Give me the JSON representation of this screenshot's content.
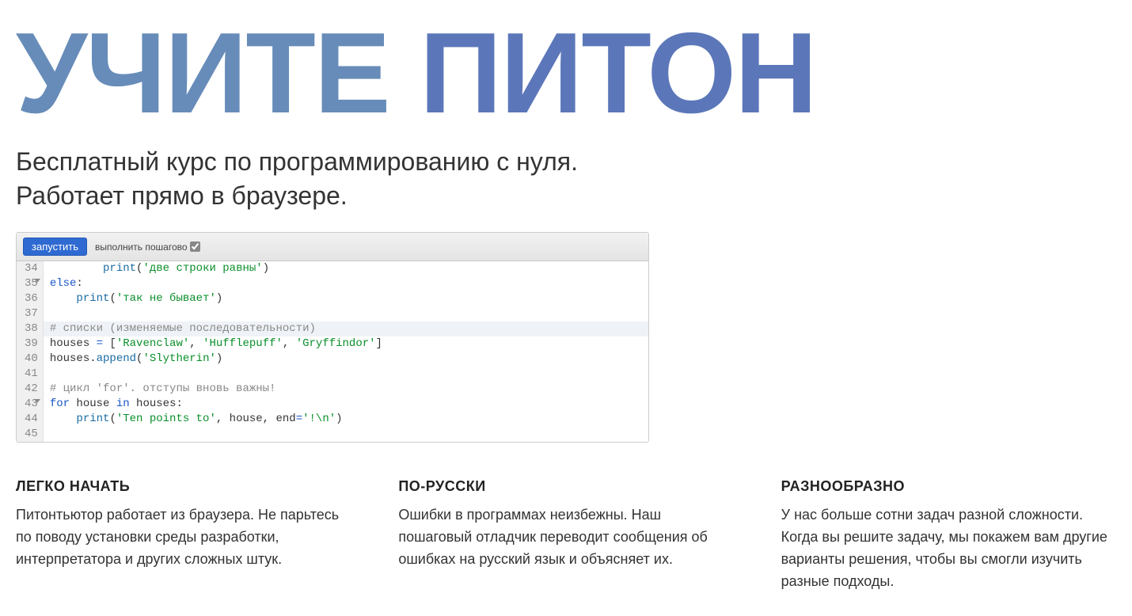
{
  "title": {
    "word1": "УЧИТЕ",
    "word2": "ПИТОН"
  },
  "subtitle_line1": "Бесплатный курс по программированию с нуля.",
  "subtitle_line2": "Работает прямо в браузере.",
  "editor": {
    "run_label": "запустить",
    "step_label": "выполнить пошагово",
    "step_checked": true,
    "line_numbers": [
      "34",
      "35",
      "36",
      "37",
      "38",
      "39",
      "40",
      "41",
      "42",
      "43",
      "44",
      "45"
    ],
    "fold_lines": [
      35,
      43
    ],
    "code_lines": [
      {
        "indent": 2,
        "tokens": [
          {
            "t": "fn",
            "v": "print"
          },
          {
            "t": "",
            "v": "("
          },
          {
            "t": "str",
            "v": "'две строки равны'"
          },
          {
            "t": "",
            "v": ")"
          }
        ]
      },
      {
        "indent": 0,
        "tokens": [
          {
            "t": "kw",
            "v": "else"
          },
          {
            "t": "",
            "v": ":"
          }
        ]
      },
      {
        "indent": 1,
        "tokens": [
          {
            "t": "fn",
            "v": "print"
          },
          {
            "t": "",
            "v": "("
          },
          {
            "t": "str",
            "v": "'так не бывает'"
          },
          {
            "t": "",
            "v": ")"
          }
        ]
      },
      {
        "indent": 0,
        "tokens": []
      },
      {
        "indent": 0,
        "highlight": true,
        "tokens": [
          {
            "t": "com",
            "v": "# списки (изменяемые последовательности)"
          }
        ]
      },
      {
        "indent": 0,
        "tokens": [
          {
            "t": "",
            "v": "houses "
          },
          {
            "t": "op",
            "v": "="
          },
          {
            "t": "",
            "v": " ["
          },
          {
            "t": "str",
            "v": "'Ravenclaw'"
          },
          {
            "t": "",
            "v": ", "
          },
          {
            "t": "str",
            "v": "'Hufflepuff'"
          },
          {
            "t": "",
            "v": ", "
          },
          {
            "t": "str",
            "v": "'Gryffindor'"
          },
          {
            "t": "",
            "v": "]"
          }
        ]
      },
      {
        "indent": 0,
        "tokens": [
          {
            "t": "",
            "v": "houses."
          },
          {
            "t": "fn",
            "v": "append"
          },
          {
            "t": "",
            "v": "("
          },
          {
            "t": "str",
            "v": "'Slytherin'"
          },
          {
            "t": "",
            "v": ")"
          }
        ]
      },
      {
        "indent": 0,
        "tokens": []
      },
      {
        "indent": 0,
        "tokens": [
          {
            "t": "com",
            "v": "# цикл 'for'. отступы вновь важны!"
          }
        ]
      },
      {
        "indent": 0,
        "tokens": [
          {
            "t": "kw",
            "v": "for"
          },
          {
            "t": "",
            "v": " house "
          },
          {
            "t": "kw",
            "v": "in"
          },
          {
            "t": "",
            "v": " houses:"
          }
        ]
      },
      {
        "indent": 1,
        "tokens": [
          {
            "t": "fn",
            "v": "print"
          },
          {
            "t": "",
            "v": "("
          },
          {
            "t": "str",
            "v": "'Ten points to'"
          },
          {
            "t": "",
            "v": ", house, end"
          },
          {
            "t": "op",
            "v": "="
          },
          {
            "t": "str",
            "v": "'!\\n'"
          },
          {
            "t": "",
            "v": ")"
          }
        ]
      },
      {
        "indent": 0,
        "tokens": []
      }
    ]
  },
  "features": [
    {
      "title": "ЛЕГКО НАЧАТЬ",
      "text": "Питонтьютор работает из браузера. Не парьтесь по поводу установки среды разработки, интерпретатора и других сложных штук."
    },
    {
      "title": "ПО-РУССКИ",
      "text": "Ошибки в программах неизбежны. Наш пошаговый отладчик переводит сообщения об ошибках на русский язык и объясняет их."
    },
    {
      "title": "РАЗНООБРАЗНО",
      "text": "У нас больше сотни задач разной сложности. Когда вы решите задачу, мы покажем вам другие варианты решения, чтобы вы смогли изучить разные подходы."
    }
  ]
}
